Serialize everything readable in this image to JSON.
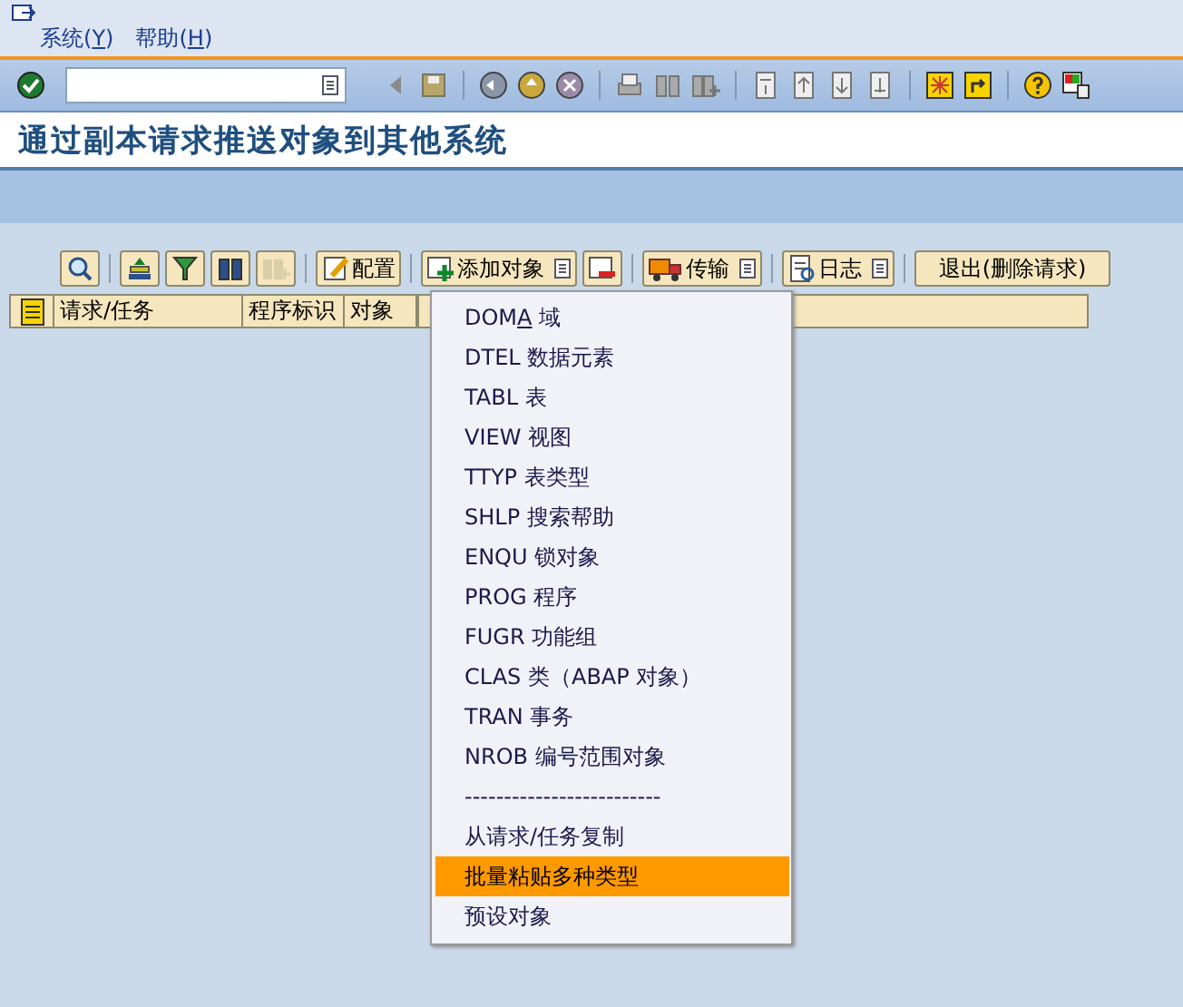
{
  "menu_bar": [
    {
      "before": "系统(",
      "key": "Y",
      "after": ")"
    },
    {
      "before": "帮助(",
      "key": "H",
      "after": ")"
    }
  ],
  "title": "通过副本请求推送对象到其他系统",
  "app_toolbar": [
    {
      "label": "配置",
      "has_menu": false
    },
    {
      "label": "添加对象",
      "has_menu": true
    },
    {
      "label": "传输",
      "has_menu": true
    },
    {
      "label": "日志",
      "has_menu": true
    },
    {
      "label": "退出(删除请求)",
      "has_menu": false
    }
  ],
  "table": {
    "columns": [
      "请求/任务",
      "程序标识",
      "对象"
    ]
  },
  "dropdown_menu": [
    {
      "before": "DOM",
      "key": "A",
      "after": " 域",
      "selected": false
    },
    {
      "label": "DTEL 数据元素",
      "selected": false
    },
    {
      "label": "TABL 表",
      "selected": false
    },
    {
      "label": "VIEW 视图",
      "selected": false
    },
    {
      "label": "TTYP 表类型",
      "selected": false
    },
    {
      "label": "SHLP 搜索帮助",
      "selected": false
    },
    {
      "label": "ENQU 锁对象",
      "selected": false
    },
    {
      "label": "PROG 程序",
      "selected": false
    },
    {
      "label": "FUGR 功能组",
      "selected": false
    },
    {
      "label": "CLAS 类（ABAP 对象）",
      "selected": false
    },
    {
      "label": "TRAN 事务",
      "selected": false
    },
    {
      "label": "NROB 编号范围对象",
      "selected": false
    },
    {
      "label": "-------------------------",
      "selected": false
    },
    {
      "label": "从请求/任务复制",
      "selected": false
    },
    {
      "label": "批量粘贴多种类型",
      "selected": true
    },
    {
      "label": "预设对象",
      "selected": false
    }
  ]
}
